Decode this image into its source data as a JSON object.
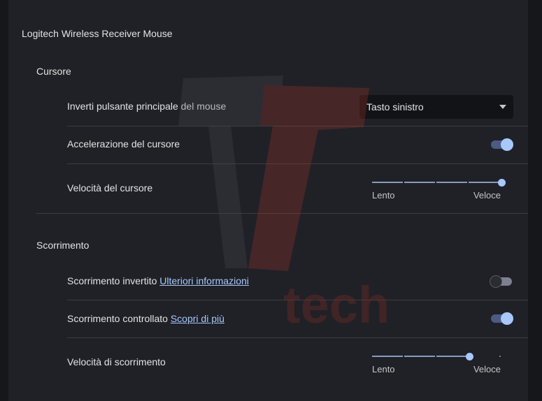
{
  "page": {
    "title": "Logitech Wireless Receiver Mouse"
  },
  "cursor_section": {
    "heading": "Cursore",
    "primary_button": {
      "label": "Inverti pulsante principale del mouse",
      "value": "Tasto sinistro"
    },
    "acceleration": {
      "label": "Accelerazione del cursore",
      "enabled": true
    },
    "speed": {
      "label": "Velocità del cursore",
      "min_label": "Lento",
      "max_label": "Veloce",
      "level_fraction": 1.0
    }
  },
  "scroll_section": {
    "heading": "Scorrimento",
    "inverted": {
      "label": "Scorrimento invertito",
      "link": "Ulteriori informazioni",
      "enabled": false
    },
    "controlled": {
      "label": "Scorrimento controllato",
      "link": "Scopri di più",
      "enabled": true
    },
    "speed": {
      "label": "Velocità di scorrimento",
      "min_label": "Lento",
      "max_label": "Veloce",
      "level_fraction": 0.75
    }
  },
  "watermark": {
    "text": "tech"
  },
  "colors": {
    "accent": "#a8c7fa",
    "background": "#1f2127",
    "watermark": "#7a2a24"
  },
  "icons": {
    "dropdown": "chevron-down-icon",
    "watermark_logo": "t-logo-icon"
  }
}
